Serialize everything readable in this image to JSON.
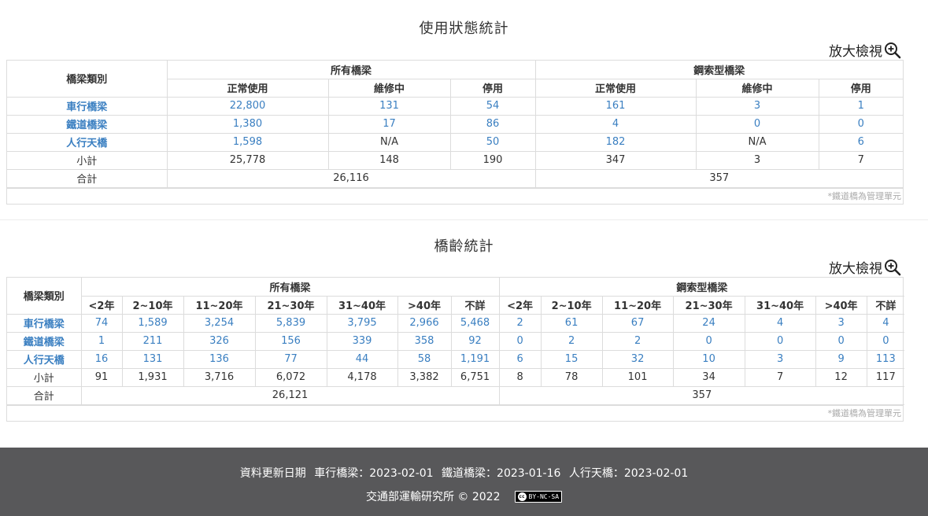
{
  "usage": {
    "title": "使用狀態統計",
    "zoom_label": "放大檢視",
    "header": {
      "category": "橋梁類別",
      "group_all": "所有橋梁",
      "group_cable": "鋼索型橋梁",
      "cols": [
        "正常使用",
        "維修中",
        "停用",
        "正常使用",
        "維修中",
        "停用"
      ]
    },
    "rows": [
      {
        "label": "車行橋梁",
        "values": [
          "22,800",
          "131",
          "54",
          "161",
          "3",
          "1"
        ]
      },
      {
        "label": "鐵道橋梁",
        "values": [
          "1,380",
          "17",
          "86",
          "4",
          "0",
          "0"
        ]
      },
      {
        "label": "人行天橋",
        "values": [
          "1,598",
          "N/A",
          "50",
          "182",
          "N/A",
          "6"
        ]
      }
    ],
    "subtotal": {
      "label": "小計",
      "values": [
        "25,778",
        "148",
        "190",
        "347",
        "3",
        "7"
      ]
    },
    "total": {
      "label": "合計",
      "all": "26,116",
      "cable": "357"
    },
    "note": "*鐵道橋為管理單元"
  },
  "age": {
    "title": "橋齡統計",
    "zoom_label": "放大檢視",
    "header": {
      "category": "橋梁類別",
      "group_all": "所有橋梁",
      "group_cable": "鋼索型橋梁",
      "cols": [
        "<2年",
        "2~10年",
        "11~20年",
        "21~30年",
        "31~40年",
        ">40年",
        "不詳",
        "<2年",
        "2~10年",
        "11~20年",
        "21~30年",
        "31~40年",
        ">40年",
        "不詳"
      ]
    },
    "rows": [
      {
        "label": "車行橋梁",
        "values": [
          "74",
          "1,589",
          "3,254",
          "5,839",
          "3,795",
          "2,966",
          "5,468",
          "2",
          "61",
          "67",
          "24",
          "4",
          "3",
          "4"
        ]
      },
      {
        "label": "鐵道橋梁",
        "values": [
          "1",
          "211",
          "326",
          "156",
          "339",
          "358",
          "92",
          "0",
          "2",
          "2",
          "0",
          "0",
          "0",
          "0"
        ]
      },
      {
        "label": "人行天橋",
        "values": [
          "16",
          "131",
          "136",
          "77",
          "44",
          "58",
          "1,191",
          "6",
          "15",
          "32",
          "10",
          "3",
          "9",
          "113"
        ]
      }
    ],
    "subtotal": {
      "label": "小計",
      "values": [
        "91",
        "1,931",
        "3,716",
        "6,072",
        "4,178",
        "3,382",
        "6,751",
        "8",
        "78",
        "101",
        "34",
        "7",
        "12",
        "117"
      ]
    },
    "total": {
      "label": "合計",
      "all": "26,121",
      "cable": "357"
    },
    "note": "*鐵道橋為管理單元"
  },
  "footer": {
    "update_label": "資料更新日期",
    "road": "車行橋梁：2023-02-01",
    "rail": "鐵道橋梁：2023-01-16",
    "ped": "人行天橋：2023-02-01",
    "copyright": "交通部運輸研究所 © 2022",
    "license": "BY-NC-SA",
    "license_icon": "cc"
  },
  "colors": {
    "link_blue": "#3a7fc1",
    "footer_bg": "#58585a",
    "border": "#dcdcdc"
  }
}
